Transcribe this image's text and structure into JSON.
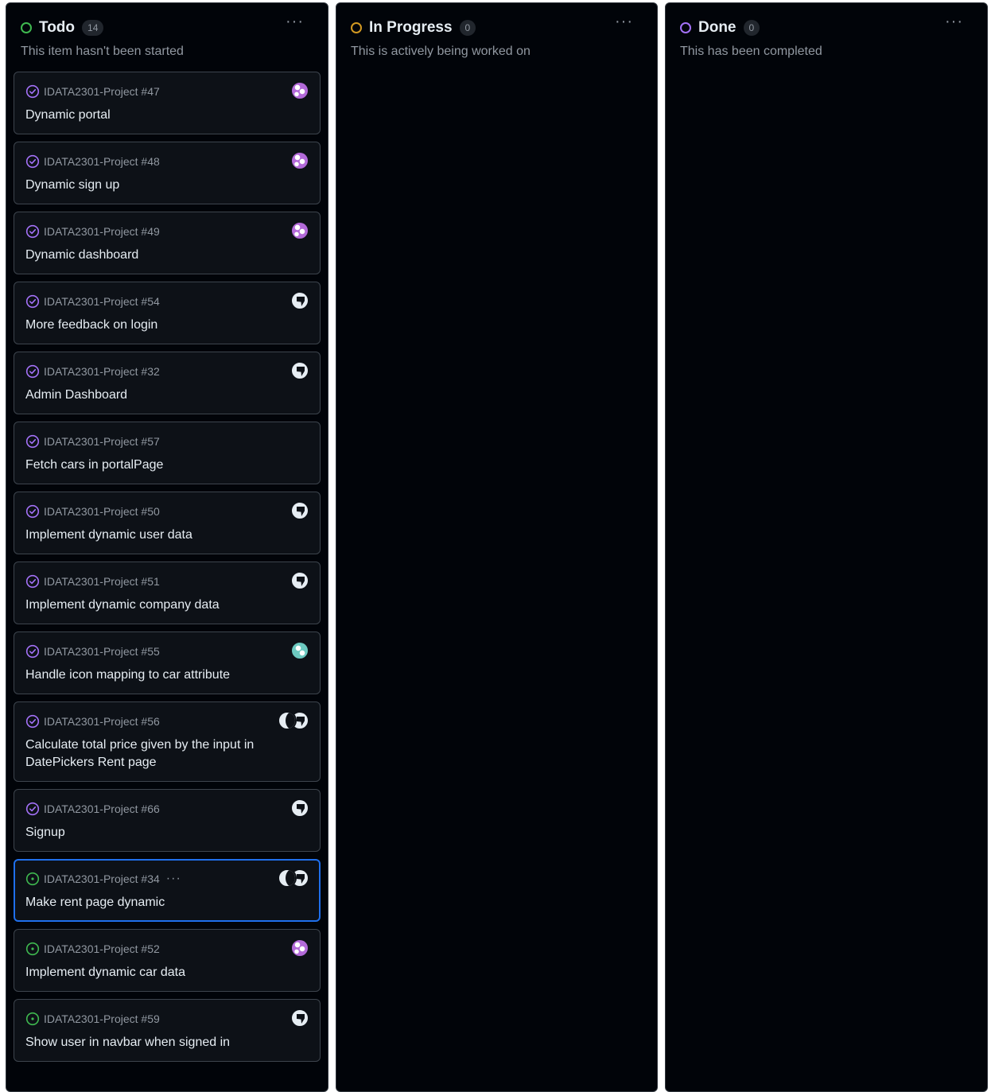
{
  "columns": [
    {
      "title": "Todo",
      "count": "14",
      "description": "This item hasn't been started",
      "status_color": "#3fb950",
      "cards": [
        {
          "ref": "IDATA2301-Project #47",
          "title": "Dynamic portal",
          "icon": "issue-draft-icon",
          "assignees": [
            "purple"
          ]
        },
        {
          "ref": "IDATA2301-Project #48",
          "title": "Dynamic sign up",
          "icon": "issue-draft-icon",
          "assignees": [
            "purple"
          ]
        },
        {
          "ref": "IDATA2301-Project #49",
          "title": "Dynamic dashboard",
          "icon": "issue-draft-icon",
          "assignees": [
            "purple"
          ]
        },
        {
          "ref": "IDATA2301-Project #54",
          "title": "More feedback on login",
          "icon": "issue-draft-icon",
          "assignees": [
            "white"
          ]
        },
        {
          "ref": "IDATA2301-Project #32",
          "title": "Admin Dashboard",
          "icon": "issue-draft-icon",
          "assignees": [
            "white"
          ]
        },
        {
          "ref": "IDATA2301-Project #57",
          "title": "Fetch cars in portalPage",
          "icon": "issue-draft-icon",
          "assignees": []
        },
        {
          "ref": "IDATA2301-Project #50",
          "title": "Implement dynamic user data",
          "icon": "issue-draft-icon",
          "assignees": [
            "white"
          ]
        },
        {
          "ref": "IDATA2301-Project #51",
          "title": "Implement dynamic company data",
          "icon": "issue-draft-icon",
          "assignees": [
            "white"
          ]
        },
        {
          "ref": "IDATA2301-Project #55",
          "title": "Handle icon mapping to car attribute",
          "icon": "issue-draft-icon",
          "assignees": [
            "teal"
          ]
        },
        {
          "ref": "IDATA2301-Project #56",
          "title": "Calculate total price given by the input in DatePickers Rent page",
          "icon": "issue-draft-icon",
          "assignees": [
            "white",
            "moon"
          ]
        },
        {
          "ref": "IDATA2301-Project #66",
          "title": "Signup",
          "icon": "issue-draft-icon",
          "assignees": [
            "white"
          ]
        },
        {
          "ref": "IDATA2301-Project #34",
          "title": "Make rent page dynamic",
          "icon": "issue-open-icon",
          "assignees": [
            "white",
            "moon"
          ],
          "selected": true,
          "more": "···"
        },
        {
          "ref": "IDATA2301-Project #52",
          "title": "Implement dynamic car data",
          "icon": "issue-open-icon",
          "assignees": [
            "purple"
          ]
        },
        {
          "ref": "IDATA2301-Project #59",
          "title": "Show user in navbar when signed in",
          "icon": "issue-open-icon",
          "assignees": [
            "white"
          ]
        }
      ]
    },
    {
      "title": "In Progress",
      "count": "0",
      "description": "This is actively being worked on",
      "status_color": "#d29922",
      "cards": []
    },
    {
      "title": "Done",
      "count": "0",
      "description": "This has been completed",
      "status_color": "#a371f7",
      "cards": []
    }
  ],
  "menu_glyph": "···",
  "colors": {
    "background": "#010409",
    "card_bg": "#0d1117",
    "card_border": "#3d444d",
    "selected_border": "#1f6feb",
    "draft_icon": "#a371f7",
    "open_icon": "#3fb950"
  }
}
